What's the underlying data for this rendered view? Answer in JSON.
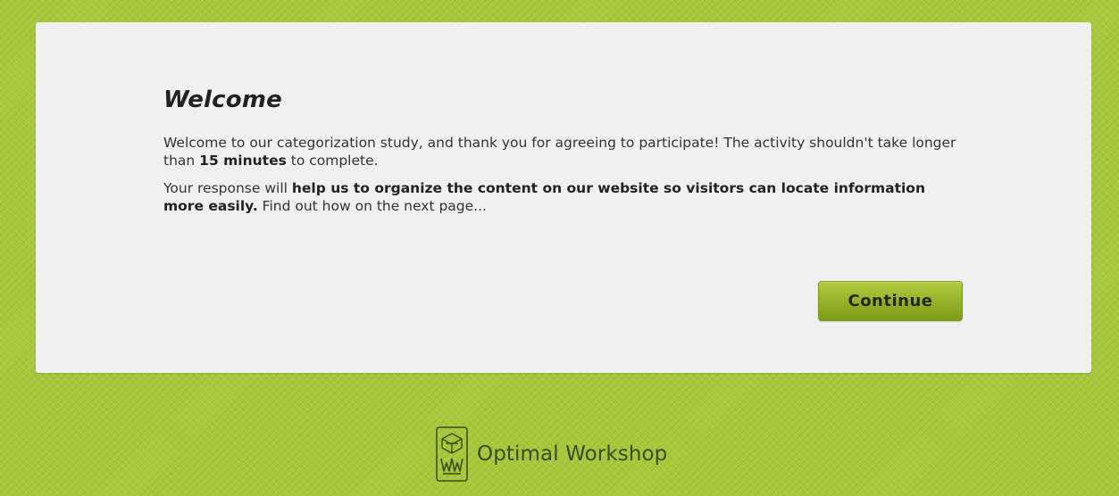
{
  "welcome": {
    "title": "Welcome",
    "intro": "Welcome to our categorization study, and thank you for agreeing to participate! The activity shouldn't take longer than ",
    "duration": "15 minutes",
    "intro_end": " to complete.",
    "response_lead": "Your response will ",
    "response_bold": "help us to organize the content on our website so visitors can locate information more easily.",
    "response_tail": " Find out how on the next page...",
    "continue_label": "Continue"
  },
  "footer": {
    "brand": "Optimal Workshop",
    "logo_icon": "optimal-workshop-logo-icon"
  },
  "colors": {
    "background": "#a6c83a",
    "card": "#f0f0f0",
    "button": "#9ab52e",
    "text": "#333333"
  }
}
